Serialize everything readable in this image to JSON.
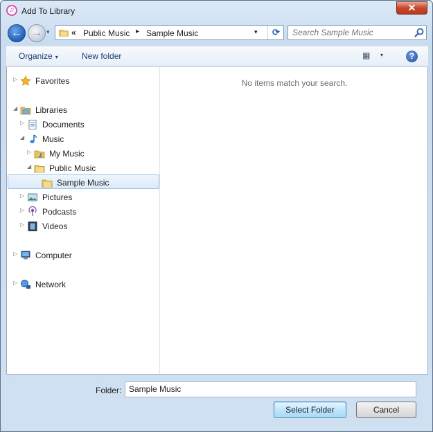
{
  "window": {
    "title": "Add To Library",
    "close_glyph": "✕"
  },
  "nav": {
    "back_glyph": "←",
    "forward_glyph": "→",
    "history_glyph": "▾"
  },
  "address": {
    "overflow_glyph": "«",
    "crumbs": [
      "Public Music",
      "Sample Music"
    ],
    "separator_glyph": "▸",
    "dropdown_glyph": "▾",
    "refresh_glyph": "⟳"
  },
  "search": {
    "placeholder": "Search Sample Music"
  },
  "toolbar": {
    "organize_label": "Organize",
    "organize_caret": "▾",
    "new_folder_label": "New folder",
    "views_glyph": "▦",
    "views_caret": "▾",
    "help_glyph": "?"
  },
  "tree": {
    "favorites": "Favorites",
    "libraries": "Libraries",
    "documents": "Documents",
    "music": "Music",
    "my_music": "My Music",
    "public_music": "Public Music",
    "sample_music": "Sample Music",
    "pictures": "Pictures",
    "podcasts": "Podcasts",
    "videos": "Videos",
    "computer": "Computer",
    "network": "Network",
    "collapsed_glyph": "▷",
    "expanded_glyph": "◢"
  },
  "content": {
    "empty_message": "No items match your search."
  },
  "footer": {
    "folder_label": "Folder:",
    "folder_value": "Sample Music",
    "select_button": "Select Folder",
    "cancel_button": "Cancel"
  },
  "colors": {
    "accent": "#1f5fb8",
    "selection_bg": "#dbeaf9",
    "close_red": "#c9472c"
  }
}
